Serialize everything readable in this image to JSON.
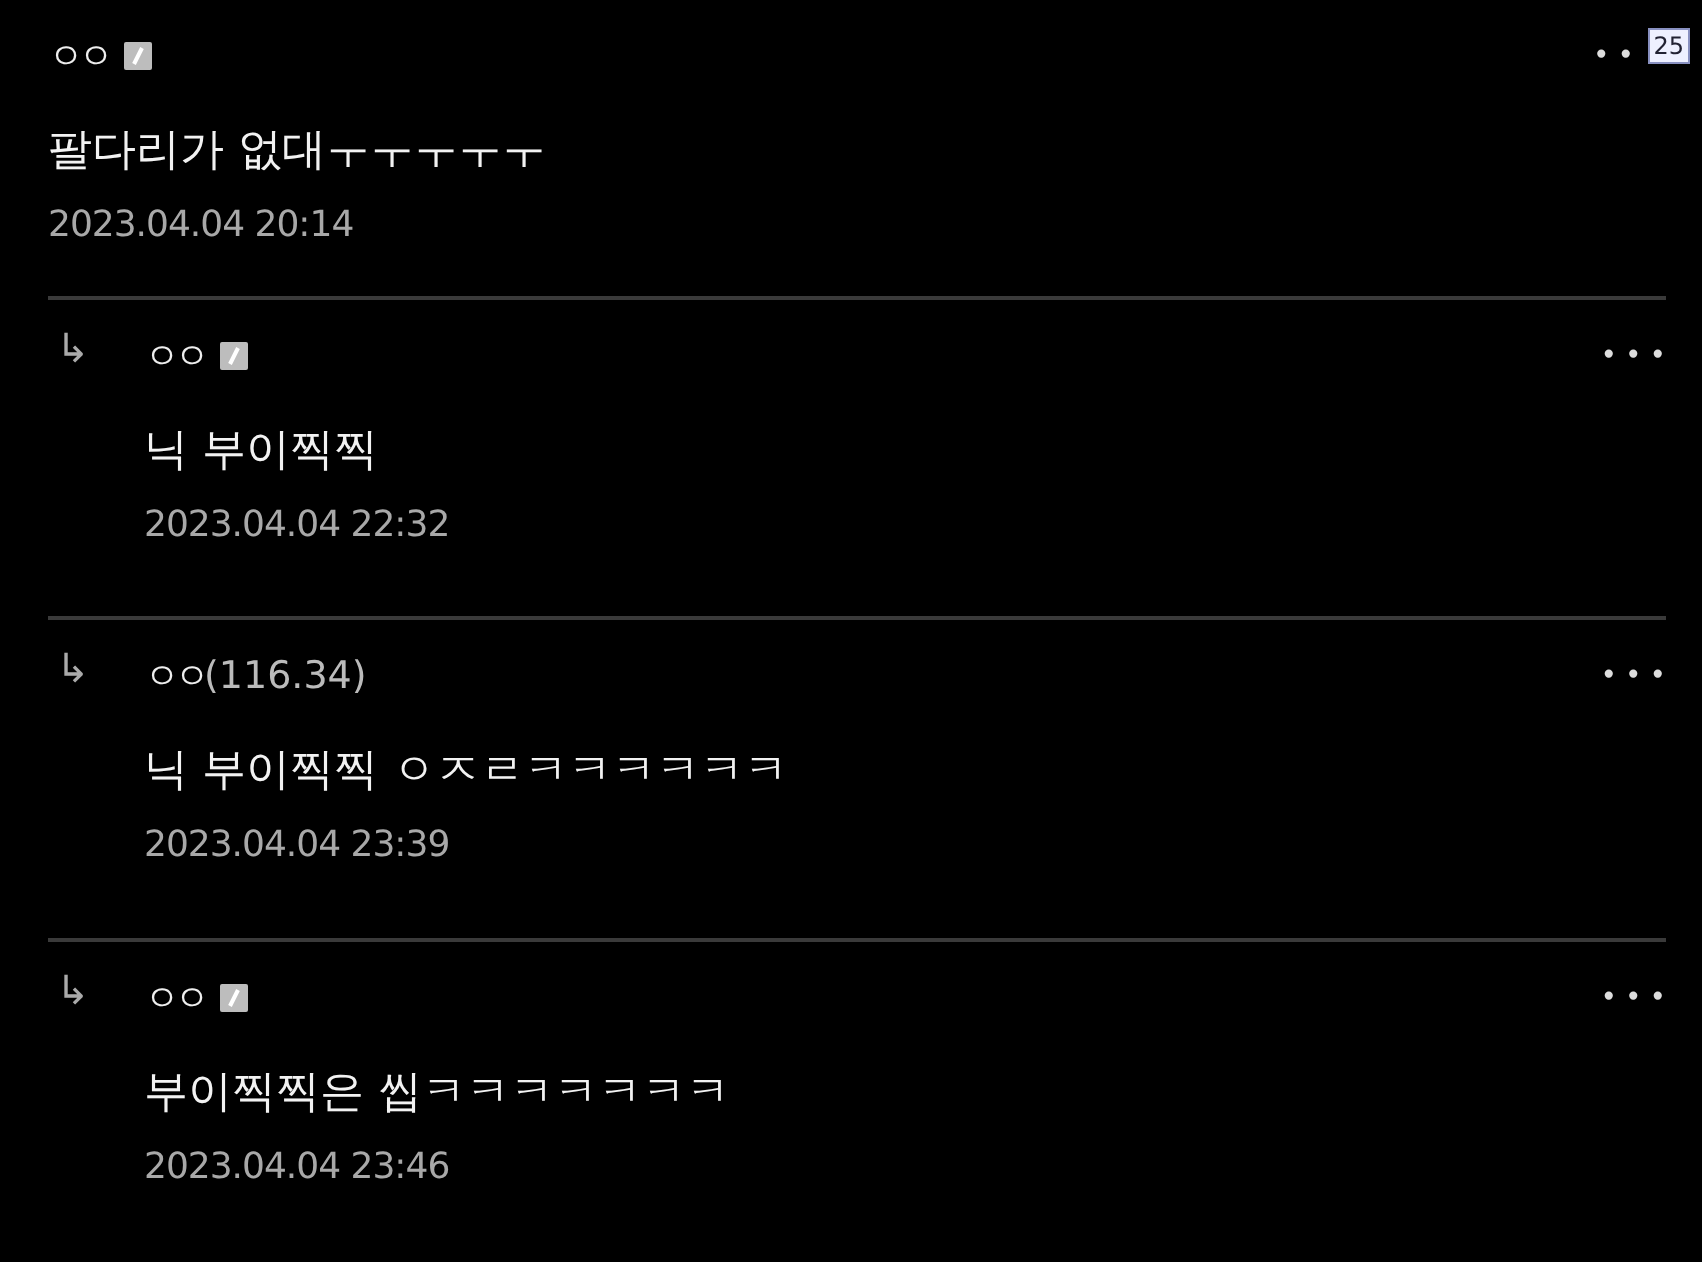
{
  "page_number": "25",
  "comments": [
    {
      "kind": "comment",
      "author": "ㅇㅇ",
      "member": true,
      "body": "팔다리가 없대ㅜㅜㅜㅜㅜ",
      "date": "2023.04.04 20:14",
      "more": "••"
    },
    {
      "kind": "reply",
      "arrow": "↳",
      "author": "ㅇㅇ",
      "member": true,
      "body": "닉 부이찍찍",
      "date": "2023.04.04 22:32",
      "more": "•••"
    },
    {
      "kind": "reply",
      "arrow": "↳",
      "author": "ㅇㅇ",
      "ip": "(116.34)",
      "member": false,
      "body": "닉 부이찍찍 ㅇㅈㄹㅋㅋㅋㅋㅋㅋ",
      "date": "2023.04.04 23:39",
      "more": "•••"
    },
    {
      "kind": "reply",
      "arrow": "↳",
      "author": "ㅇㅇ",
      "member": true,
      "body": "부이찍찍은 씹ㅋㅋㅋㅋㅋㅋㅋ",
      "date": "2023.04.04 23:46",
      "more": "•••"
    }
  ]
}
